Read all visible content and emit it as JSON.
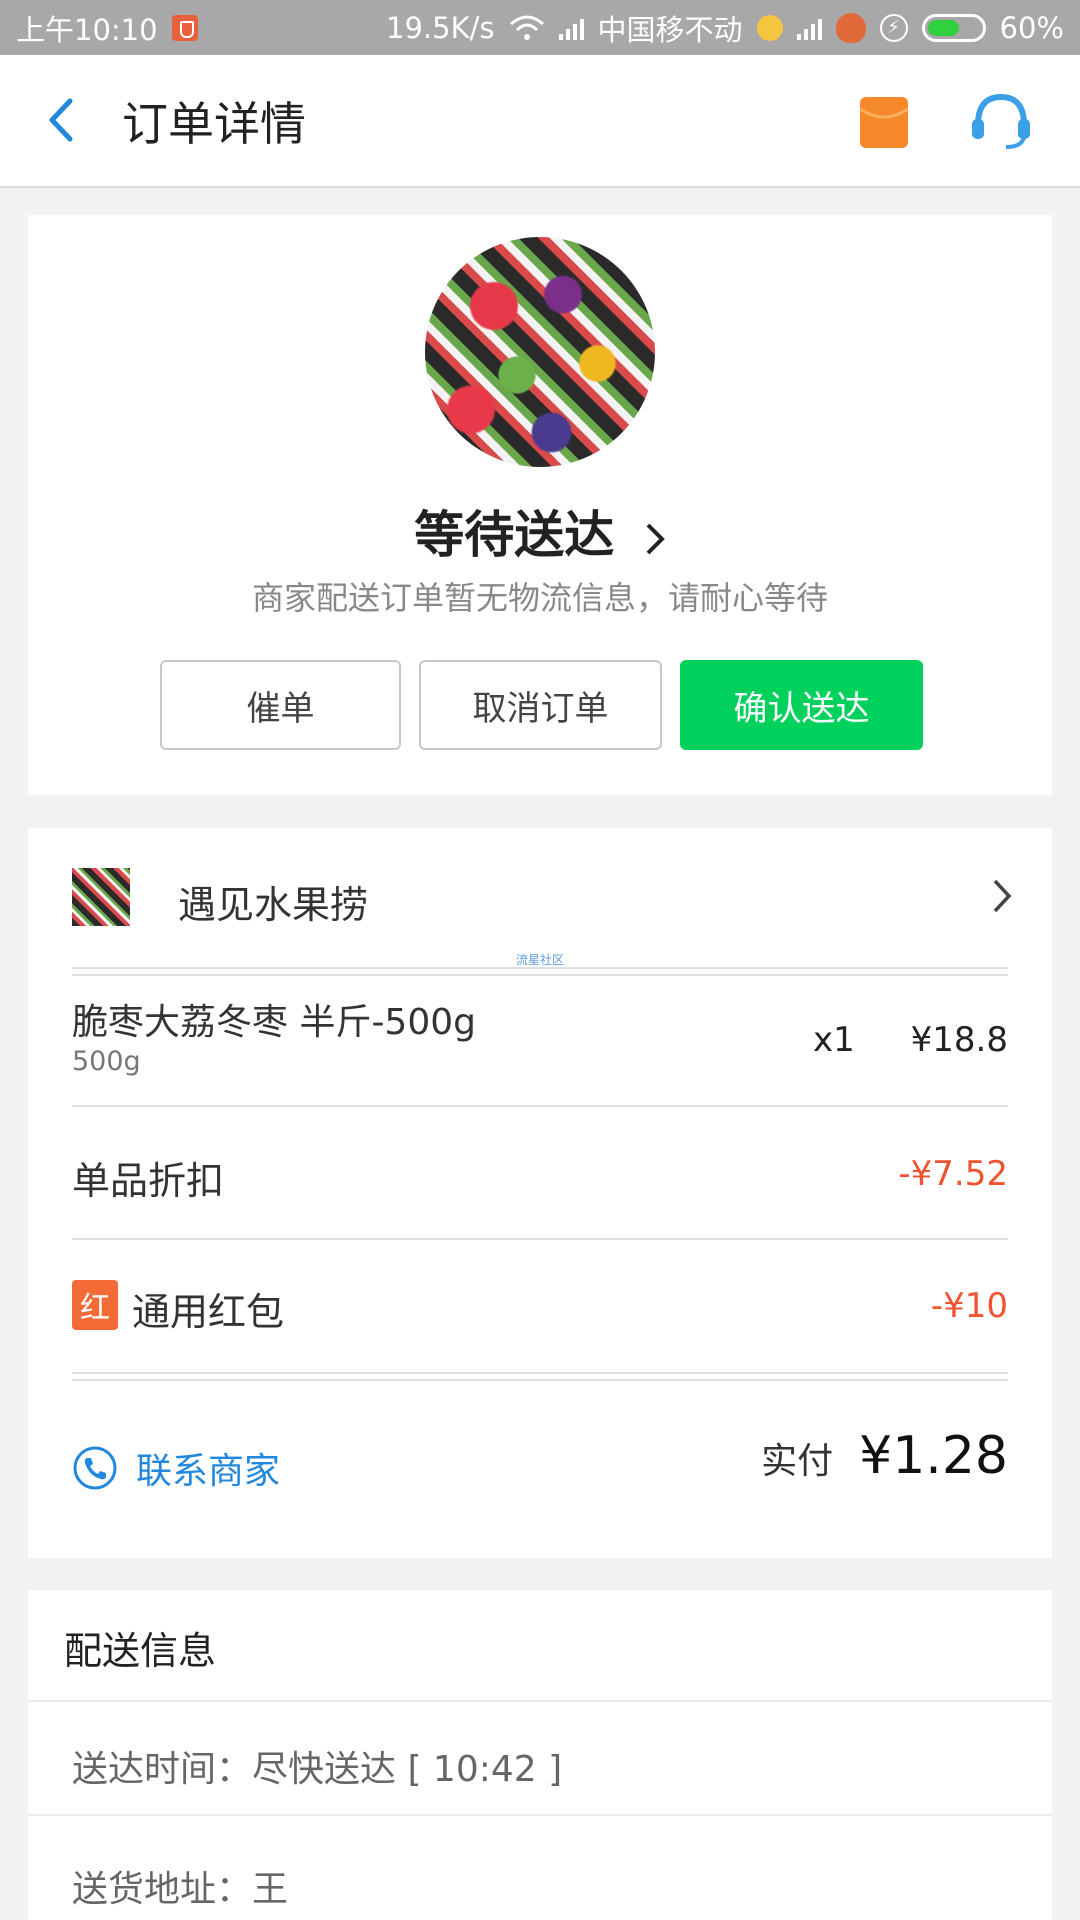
{
  "status_bar": {
    "time": "上午10:10",
    "speed": "19.5K/s",
    "carrier": "中国移不动",
    "battery": "60%",
    "battery_level": 0.6
  },
  "header": {
    "title": "订单详情",
    "icons": [
      "back-arrow-icon",
      "shopping-bag-icon",
      "customer-service-icon"
    ]
  },
  "status": {
    "title": "等待送达",
    "subtitle": "商家配送订单暂无物流信息，请耐心等待",
    "buttons": {
      "urge": "催单",
      "cancel": "取消订单",
      "confirm": "确认送达"
    }
  },
  "order": {
    "shop_name": "遇见水果捞",
    "watermark": "流星社区",
    "item": {
      "name": "脆枣大荔冬枣 半斤-500g",
      "spec": "500g",
      "qty": "x1",
      "price": "¥18.8"
    },
    "discount": {
      "label": "单品折扣",
      "amount": "-¥7.52"
    },
    "redpacket": {
      "tag": "红",
      "label": "通用红包",
      "amount": "-¥10"
    },
    "contact_label": "联系商家",
    "paid_label": "实付",
    "paid_value": "¥1.28"
  },
  "delivery": {
    "title": "配送信息",
    "time": "送达时间：尽快送达 [ 10:42 ]",
    "address": "送货地址：王"
  },
  "colors": {
    "accent_blue": "#2288dd",
    "confirm_green": "#00d15d",
    "discount_red": "#f0532f",
    "bag_orange": "#f5892a"
  }
}
